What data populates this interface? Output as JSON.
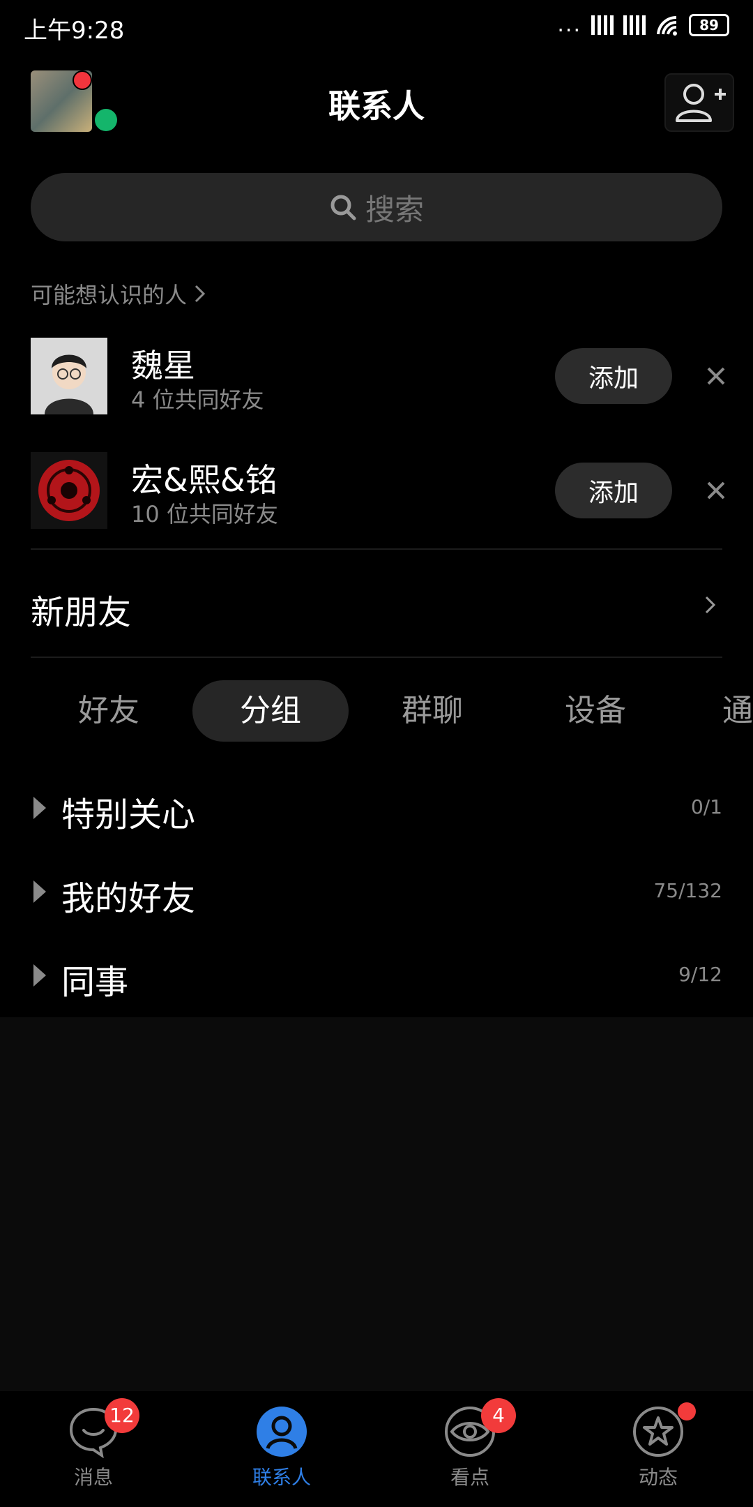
{
  "status_bar": {
    "time": "上午9:28",
    "signal_dots": "...",
    "battery": "89"
  },
  "header": {
    "title": "联系人",
    "add_contact_icon": "add-person-icon"
  },
  "search": {
    "placeholder": "搜索"
  },
  "suggestions": {
    "heading": "可能想认识的人",
    "people": [
      {
        "name": "魏星",
        "mutual": "4 位共同好友",
        "action": "添加"
      },
      {
        "name": "宏&熙&铭",
        "mutual": "10 位共同好友",
        "action": "添加"
      }
    ]
  },
  "new_friends": {
    "label": "新朋友"
  },
  "tabs": [
    "好友",
    "分组",
    "群聊",
    "设备",
    "通"
  ],
  "active_tab": "分组",
  "groups": [
    {
      "name": "特别关心",
      "count": "0/1"
    },
    {
      "name": "我的好友",
      "count": "75/132"
    },
    {
      "name": "同事",
      "count": "9/12"
    }
  ],
  "bottom_nav": [
    {
      "label": "消息",
      "badge": "12",
      "icon": "chat-bubble-icon"
    },
    {
      "label": "联系人",
      "icon": "person-icon",
      "active": true
    },
    {
      "label": "看点",
      "badge": "4",
      "icon": "eye-icon"
    },
    {
      "label": "动态",
      "icon": "star-icon",
      "dot": true
    }
  ],
  "colors": {
    "accent": "#2f7fe6",
    "badge": "#f23b3b",
    "online": "#14b56b"
  }
}
